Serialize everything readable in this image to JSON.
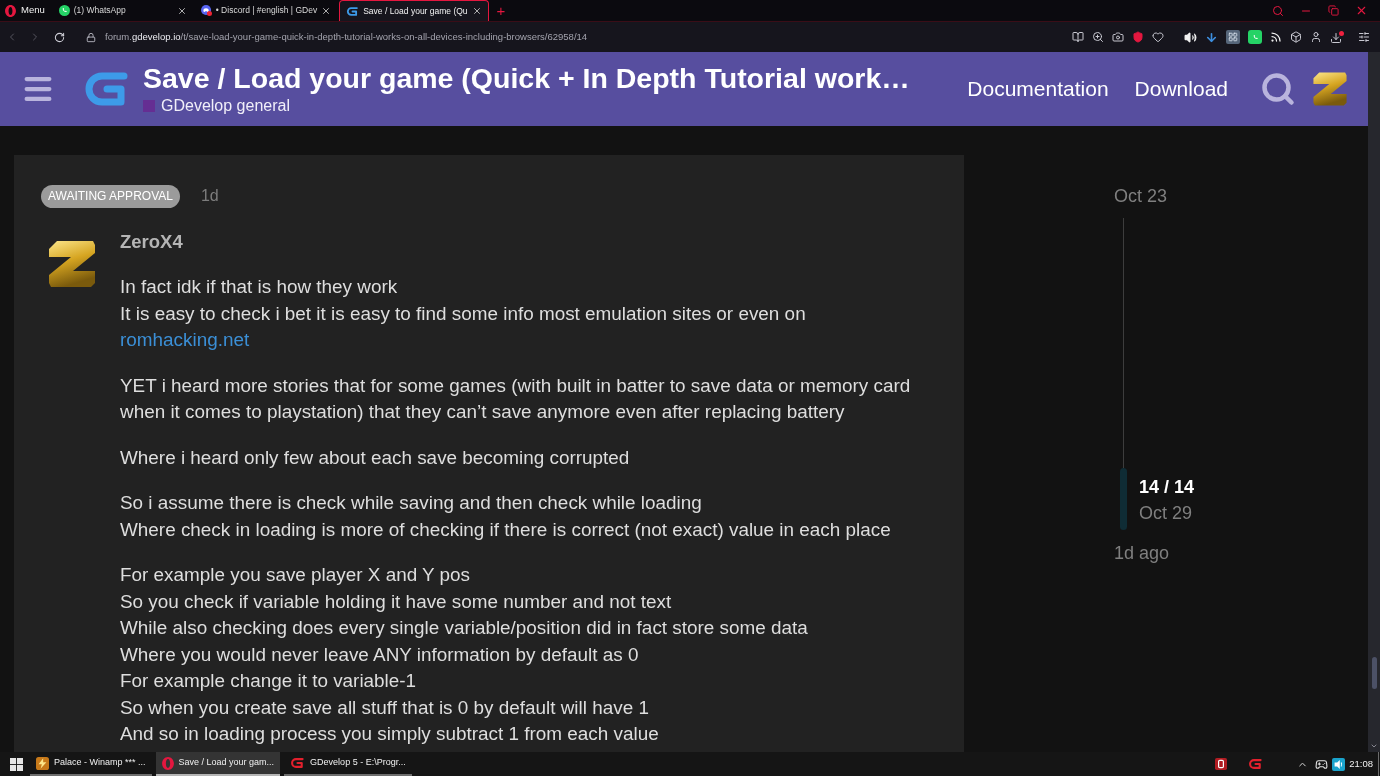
{
  "browser": {
    "menu_label": "Menu",
    "tabs": [
      {
        "title": "(1) WhatsApp",
        "selected": false
      },
      {
        "title": "• Discord | #english | GDev",
        "selected": false
      },
      {
        "title": "Save / Load your game (Qu",
        "selected": true
      }
    ],
    "new_tab": "+",
    "address": {
      "subdomain": "forum.",
      "domain": "gdevelop.io",
      "path": "/t/save-load-your-game-quick-in-depth-tutorial-works-on-all-devices-including-browsers/62958/14"
    }
  },
  "site_header": {
    "title": "Save / Load your game (Quick + In Depth Tutorial work…",
    "category": "GDevelop general",
    "nav_links": [
      "Documentation",
      "Download"
    ]
  },
  "post": {
    "status_badge": "AWAITING APPROVAL",
    "age": "1d",
    "author": "ZeroX4",
    "paragraphs": [
      {
        "lines": [
          {
            "text": "In fact idk if that is how they work"
          },
          {
            "text": "It is easy to check i bet it is easy to find some info most emulation sites or even on",
            "link": "romhacking.net"
          }
        ]
      },
      {
        "lines": [
          {
            "text": "YET i heard more stories that for some games (with built in batter to save data or memory card when it comes to playstation) that they can’t save anymore even after replacing battery"
          }
        ]
      },
      {
        "lines": [
          {
            "text": "Where i heard only few about each save becoming corrupted"
          }
        ]
      },
      {
        "lines": [
          {
            "text": "So i assume there is check while saving and then check while loading"
          },
          {
            "text": "Where check in loading is more of checking if there is correct (not exact) value in each place"
          }
        ]
      },
      {
        "lines": [
          {
            "text": "For example you save player X and Y pos"
          },
          {
            "text": "So you check if variable holding it have some number and not text"
          },
          {
            "text": "While also checking does every single variable/position did in fact store some data"
          },
          {
            "text": "Where you would never leave ANY information by default as 0"
          },
          {
            "text": "For example change it to variable-1"
          },
          {
            "text": "So when you create save all stuff that is 0 by default will have 1"
          },
          {
            "text": "And so in loading process you simply subtract 1 from each value"
          }
        ]
      }
    ]
  },
  "timeline": {
    "start_date": "Oct 23",
    "position": "14 / 14",
    "current_date": "Oct 29",
    "end_label": "1d ago"
  },
  "taskbar": {
    "windows": [
      {
        "title": "Palace - Winamp *** ...",
        "selected": false
      },
      {
        "title": "Save / Load your gam...",
        "selected": true
      },
      {
        "title": "GDevelop 5 - E:\\Progr...",
        "selected": false
      }
    ],
    "clock": "21:08"
  }
}
